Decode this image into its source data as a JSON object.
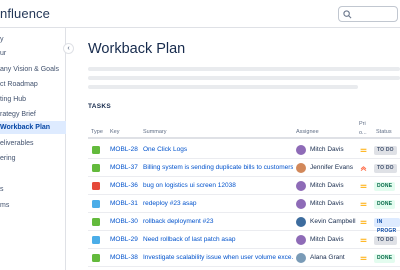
{
  "app": {
    "brand": "nfluence"
  },
  "sidebar": {
    "items": [
      {
        "label": "y"
      },
      {
        "label": "ur"
      },
      {
        "label": "any Vision & Goals"
      },
      {
        "label": "ct Roadmap"
      },
      {
        "label": "ting Hub"
      },
      {
        "label": "rategy Brief"
      },
      {
        "label": "Workback Plan",
        "active": true
      },
      {
        "label": "eliverables"
      },
      {
        "label": "ering"
      },
      {
        "label": ""
      },
      {
        "label": "s"
      },
      {
        "label": "ms"
      }
    ]
  },
  "page": {
    "title": "Workback Plan",
    "tasks_label": "TASKS"
  },
  "table": {
    "headers": {
      "type": "Type",
      "key": "Key",
      "summary": "Summary",
      "assignee": "Assignee",
      "priority": "Pri o...",
      "status": "Status"
    },
    "rows": [
      {
        "type": "story",
        "key": "MOBL-28",
        "summary": "One Click Logs",
        "assignee": "Mitch Davis",
        "priority": "medium",
        "status": "TO DO"
      },
      {
        "type": "story",
        "key": "MOBL-37",
        "summary": "Billing system is sending duplicate bills to customers",
        "assignee": "Jennifer Evans",
        "priority": "high",
        "status": "TO DO"
      },
      {
        "type": "bug",
        "key": "MOBL-36",
        "summary": "bug on logistics ui screen 12038",
        "assignee": "Mitch Davis",
        "priority": "medium",
        "status": "DONE"
      },
      {
        "type": "task",
        "key": "MOBL-31",
        "summary": "redeploy #23 asap",
        "assignee": "Mitch Davis",
        "priority": "medium",
        "status": "DONE"
      },
      {
        "type": "story",
        "key": "MOBL-30",
        "summary": "rollback deployment #23",
        "assignee": "Kevin Campbell",
        "priority": "medium",
        "status": "IN PROGR"
      },
      {
        "type": "task",
        "key": "MOBL-29",
        "summary": "Need rollback of last patch asap",
        "assignee": "Mitch Davis",
        "priority": "medium",
        "status": "TO DO"
      },
      {
        "type": "story",
        "key": "MOBL-38",
        "summary": "Investigate scalability issue when user volume exce...",
        "assignee": "Alana Grant",
        "priority": "medium",
        "status": "DONE"
      }
    ]
  },
  "colors": {
    "link": "#0052CC",
    "story": "#63BA3C",
    "bug": "#E5493A",
    "task": "#4BADE8",
    "priority_medium": "#FFAB00",
    "priority_high": "#FF7452"
  }
}
